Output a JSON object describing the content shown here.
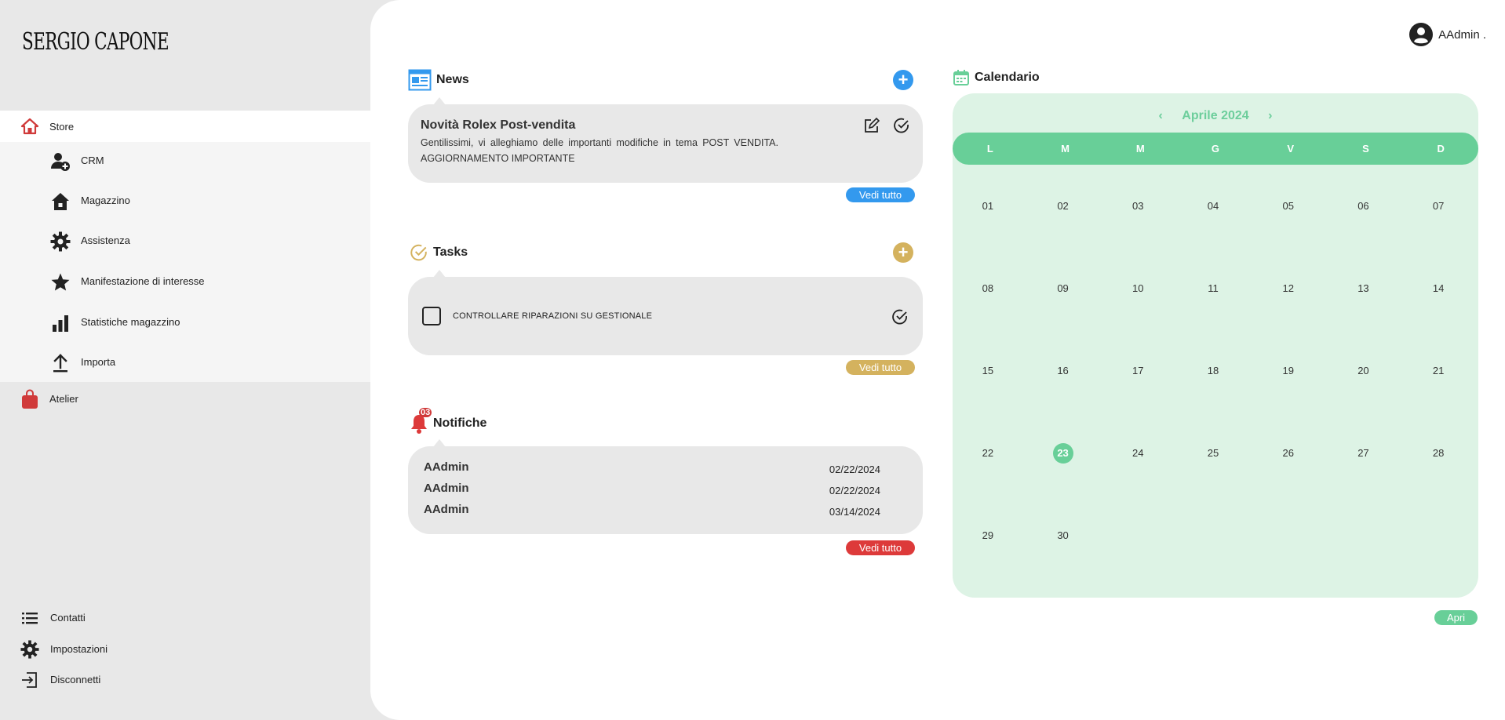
{
  "brand": {
    "logo_text": "SERGIO CAPONE"
  },
  "user": {
    "name": "AAdmin ."
  },
  "sidebar": {
    "store": {
      "label": "Store"
    },
    "submenu": [
      {
        "label": "CRM",
        "icon": "add-user-icon"
      },
      {
        "label": "Magazzino",
        "icon": "warehouse-icon"
      },
      {
        "label": "Assistenza",
        "icon": "gear-icon"
      },
      {
        "label": "Manifestazione di interesse",
        "icon": "star-icon"
      },
      {
        "label": "Statistiche magazzino",
        "icon": "bar-chart-icon"
      },
      {
        "label": "Importa",
        "icon": "upload-icon"
      }
    ],
    "atelier": {
      "label": "Atelier"
    },
    "bottom": [
      {
        "label": "Contatti",
        "icon": "list-icon"
      },
      {
        "label": "Impostazioni",
        "icon": "gear-icon"
      },
      {
        "label": "Disconnetti",
        "icon": "logout-icon"
      }
    ]
  },
  "news": {
    "title": "News",
    "item_title": "Novità Rolex Post-vendita",
    "item_body": "Gentilissimi, vi alleghiamo delle importanti modifiche in tema POST VENDITA. AGGIORNAMENTO IMPORTANTE",
    "see_all": "Vedi tutto",
    "accent": "#3399ee"
  },
  "tasks": {
    "title": "Tasks",
    "item_label": "CONTROLLARE RIPARAZIONI SU GESTIONALE",
    "see_all": "Vedi tutto",
    "accent": "#d4b25e"
  },
  "notifications": {
    "title": "Notifiche",
    "badge": "03",
    "rows": [
      {
        "who": "AAdmin",
        "when": "02/22/2024"
      },
      {
        "who": "AAdmin",
        "when": "02/22/2024"
      },
      {
        "who": "AAdmin",
        "when": "03/14/2024"
      }
    ],
    "see_all": "Vedi tutto",
    "accent": "#dd3a3a"
  },
  "calendar": {
    "title": "Calendario",
    "month_label": "Aprile 2024",
    "weekdays": [
      "L",
      "M",
      "M",
      "G",
      "V",
      "S",
      "D"
    ],
    "days": [
      "01",
      "02",
      "03",
      "04",
      "05",
      "06",
      "07",
      "08",
      "09",
      "10",
      "11",
      "12",
      "13",
      "14",
      "15",
      "16",
      "17",
      "18",
      "19",
      "20",
      "21",
      "22",
      "23",
      "24",
      "25",
      "26",
      "27",
      "28",
      "29",
      "30"
    ],
    "today": "23",
    "open_label": "Apri",
    "accent": "#68cf98"
  }
}
